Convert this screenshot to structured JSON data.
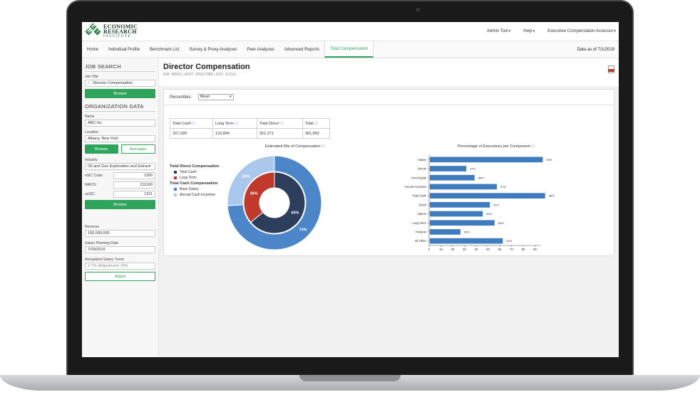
{
  "topbar": {
    "logo_line1": "ECONOMIC",
    "logo_line2": "RESEARCH",
    "logo_line3": "INSTITUTE",
    "logo_letters": [
      "E",
      "R",
      "I"
    ],
    "menus": [
      "Admin Tool",
      "Help",
      "Executive Compensation Assessor"
    ]
  },
  "navbar": {
    "tabs": [
      "Home",
      "Individual Profile",
      "Benchmark List",
      "Survey & Proxy Analyses",
      "Peer Analyses",
      "Advanced Reports",
      "Total Compensation"
    ],
    "active_tab": "Total Compensation",
    "data_as_of": "Data as of 7/1/2019"
  },
  "sidebar": {
    "job_search_title": "JOB SEARCH",
    "job_title_label": "Job Title",
    "job_title_value": "Director Compensation",
    "browse_label": "Browse",
    "org_data_title": "ORGANIZATION DATA",
    "name_label": "Name",
    "name_value": "ABC Inc",
    "location_label": "Location",
    "location_value": "Albany, New York",
    "location_browse": "Browse",
    "location_averages": "Averages",
    "industry_label": "Industry",
    "industry_value": "Oil and Gas Exploration and Extracti",
    "esic_label": "eSIC Code:",
    "esic_value": "1300",
    "naics_label": "NAICS:",
    "naics_value": "211100",
    "ussic_label": "usSIC:",
    "ussic_value": "1311",
    "industry_browse": "Browse",
    "revenue_label": "Revenue",
    "revenue_value": "100,000,000",
    "salary_date_label": "Salary Planning Date",
    "salary_date_value": "7/29/2019",
    "trend_label": "Annualized Salary Trend",
    "trend_value": "2.7% (Adjustment: 0%)",
    "adjust_label": "Adjust"
  },
  "main": {
    "title": "Director Compensation",
    "subtitle": "ERI: 45502 | eDOT: 189117088 | SOC: 113111",
    "percentiles_label": "Percentiles",
    "percentile_value": "Mean",
    "summary": {
      "headers": [
        "Total Cash",
        "Long Term",
        "Total Direct",
        "Total"
      ],
      "values": [
        "167,028",
        "123,894",
        "321,271",
        "361,892"
      ]
    },
    "legend": {
      "group1": "Total Direct Compensation",
      "g1_items": [
        "Total Cash",
        "Long Term"
      ],
      "group2": "Total Cash Compensation",
      "g2_items": [
        "Base Salary",
        "Annual Cash Incentive"
      ]
    }
  },
  "chart_data": [
    {
      "type": "pie",
      "title": "Estimated Mix of Compensation",
      "rings": [
        {
          "name": "Total Direct Compensation",
          "labels": [
            "Total Cash",
            "Long Term"
          ],
          "values": [
            64,
            36
          ]
        },
        {
          "name": "Total Cash Compensation",
          "labels": [
            "Base Salary",
            "Annual Cash Incentive"
          ],
          "values": [
            74,
            26
          ]
        }
      ],
      "colors": {
        "total_cash": "#2c3e5c",
        "long_term": "#c0392b",
        "base_salary": "#4a86c8",
        "annual_cash_incentive": "#a9c8ec"
      }
    },
    {
      "type": "bar",
      "orientation": "horizontal",
      "title": "Percentage of Executives per Component",
      "categories": [
        "Salary",
        "Bonus",
        "Non-Equity",
        "Annual Incentive",
        "Total Cash",
        "Stock",
        "Option",
        "Long Term",
        "Pension",
        "All Other"
      ],
      "values": [
        96,
        31,
        38,
        57,
        98,
        51,
        45,
        55,
        26,
        62
      ],
      "value_labels": [
        "96%",
        "31%",
        "38%",
        "57%",
        "98%",
        "51%",
        "45%",
        "55%",
        "26%",
        "62%"
      ],
      "xlim": [
        0,
        100
      ],
      "xticks": [
        "0",
        "10",
        "20",
        "30",
        "40",
        "50",
        "60",
        "70",
        "80",
        "90"
      ],
      "color": "#3f7bbf"
    }
  ]
}
